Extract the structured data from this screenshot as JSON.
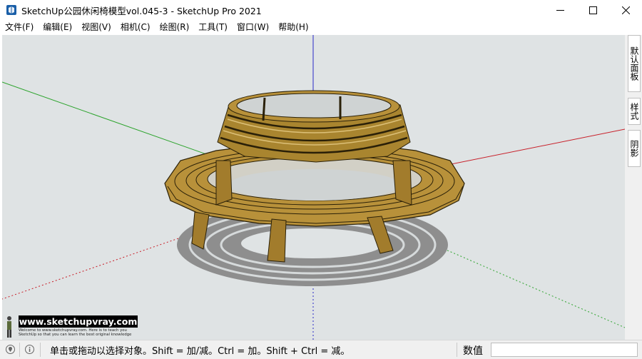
{
  "window": {
    "title": "SketchUp公园休闲椅模型vol.045-3 - SketchUp Pro 2021",
    "icon": "sketchup-logo-icon",
    "controls": [
      "minimize-icon",
      "maximize-icon",
      "close-icon"
    ]
  },
  "menu": {
    "items": [
      {
        "label": "文件(F)"
      },
      {
        "label": "编辑(E)"
      },
      {
        "label": "视图(V)"
      },
      {
        "label": "相机(C)"
      },
      {
        "label": "绘图(R)"
      },
      {
        "label": "工具(T)"
      },
      {
        "label": "窗口(W)"
      },
      {
        "label": "帮助(H)"
      }
    ]
  },
  "tray": {
    "tabs": [
      {
        "label": "默认面板"
      },
      {
        "label": "样式"
      },
      {
        "label": "阴影"
      }
    ]
  },
  "watermark": {
    "url": "www.sketchupvray.com",
    "subtitle": "Welcome to www.sketchupvray.com. Here is to teach you SketchUp so that you can learn the best original knowledge"
  },
  "viewport": {
    "background": "#dfe3e4",
    "axis_colors": {
      "red": "#c8202a",
      "green": "#2ba32b",
      "blue": "#2a2ac8"
    },
    "model": "round tree bench",
    "wood_color": "#b8913a"
  },
  "statusbar": {
    "hint": "单击或拖动以选择对象。Shift = 加/减。Ctrl = 加。Shift + Ctrl = 减。",
    "measure_label": "数值",
    "measure_value": "",
    "icons": [
      "geo-location-icon",
      "credits-info-icon"
    ]
  }
}
